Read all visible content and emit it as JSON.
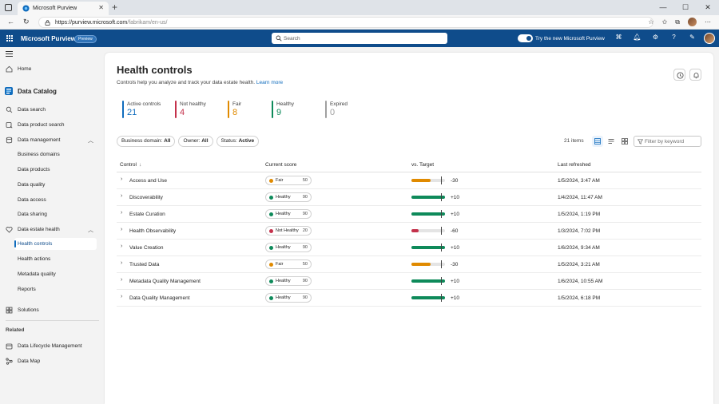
{
  "browser": {
    "tab_title": "Microsoft Purview",
    "url_host": "https://purview.microsoft.com",
    "url_path": "/fabrikam/en-us/"
  },
  "header": {
    "app_title": "Microsoft Purview",
    "badge": "Preview",
    "search_placeholder": "Search",
    "toggle_label": "Try the new Microsoft Purview"
  },
  "sidebar": {
    "home": "Home",
    "section_title": "Data Catalog",
    "items": [
      {
        "label": "Data search"
      },
      {
        "label": "Data product search"
      },
      {
        "label": "Data management"
      },
      {
        "label": "Business domains"
      },
      {
        "label": "Data products"
      },
      {
        "label": "Data quality"
      },
      {
        "label": "Data access"
      },
      {
        "label": "Data sharing"
      },
      {
        "label": "Data estate health"
      },
      {
        "label": "Health controls"
      },
      {
        "label": "Health actions"
      },
      {
        "label": "Metadata quality"
      },
      {
        "label": "Reports"
      },
      {
        "label": "Solutions"
      }
    ],
    "related_heading": "Related",
    "related": [
      {
        "label": "Data Lifecycle Management"
      },
      {
        "label": "Data Map"
      }
    ]
  },
  "page": {
    "title": "Health controls",
    "description": "Controls help you analyze and track your data estate health.",
    "learn_more": "Learn more"
  },
  "stats": [
    {
      "label": "Active controls",
      "value": "21",
      "color": "#0f6cbd"
    },
    {
      "label": "Not healthy",
      "value": "4",
      "color": "#c4314b"
    },
    {
      "label": "Fair",
      "value": "8",
      "color": "#e08a00"
    },
    {
      "label": "Healthy",
      "value": "9",
      "color": "#0e8a5a"
    },
    {
      "label": "Expired",
      "value": "0",
      "color": "#a0a0a0"
    }
  ],
  "filters": [
    {
      "label": "Business domain:",
      "value": "All"
    },
    {
      "label": "Owner:",
      "value": "All"
    },
    {
      "label": "Status:",
      "value": "Active"
    }
  ],
  "toolbar": {
    "items_count": "21 items",
    "filter_placeholder": "Filter by keyword"
  },
  "table": {
    "columns": [
      "Control",
      "Current score",
      "vs. Target",
      "Last refreshed"
    ],
    "sort_glyph": "↓",
    "rows": [
      {
        "control": "Access and Use",
        "status": "Fair",
        "score": "50",
        "delta": "-30",
        "fill": 0.56,
        "color": "#e08a00",
        "refreshed": "1/5/2024, 3:47 AM"
      },
      {
        "control": "Discoverability",
        "status": "Healthy",
        "score": "90",
        "delta": "+10",
        "fill": 1.0,
        "color": "#0e8a5a",
        "refreshed": "1/4/2024, 11:47 AM"
      },
      {
        "control": "Estate Curation",
        "status": "Healthy",
        "score": "90",
        "delta": "+10",
        "fill": 1.0,
        "color": "#0e8a5a",
        "refreshed": "1/5/2024, 1:19 PM"
      },
      {
        "control": "Health Observability",
        "status": "Not Healthy",
        "score": "20",
        "delta": "-60",
        "fill": 0.22,
        "color": "#c4314b",
        "refreshed": "1/3/2024, 7:02 PM"
      },
      {
        "control": "Value Creation",
        "status": "Healthy",
        "score": "90",
        "delta": "+10",
        "fill": 1.0,
        "color": "#0e8a5a",
        "refreshed": "1/6/2024, 9:34 AM"
      },
      {
        "control": "Trusted Data",
        "status": "Fair",
        "score": "50",
        "delta": "-30",
        "fill": 0.56,
        "color": "#e08a00",
        "refreshed": "1/5/2024, 3:21 AM"
      },
      {
        "control": "Metadata Quality Management",
        "status": "Healthy",
        "score": "90",
        "delta": "+10",
        "fill": 1.0,
        "color": "#0e8a5a",
        "refreshed": "1/6/2024, 10:55 AM"
      },
      {
        "control": "Data Quality Management",
        "status": "Healthy",
        "score": "90",
        "delta": "+10",
        "fill": 1.0,
        "color": "#0e8a5a",
        "refreshed": "1/5/2024, 6:18 PM"
      }
    ]
  },
  "icons": {
    "tab_actions": "tab-actions-icon",
    "favicon": "purview-logo-icon",
    "close": "close-icon",
    "new_tab": "plus-icon",
    "back": "back-arrow-icon",
    "refresh": "refresh-icon",
    "lock": "lock-icon",
    "waffle": "app-launcher-icon",
    "search": "search-icon",
    "history": "history-icon",
    "bell": "bell-icon"
  }
}
